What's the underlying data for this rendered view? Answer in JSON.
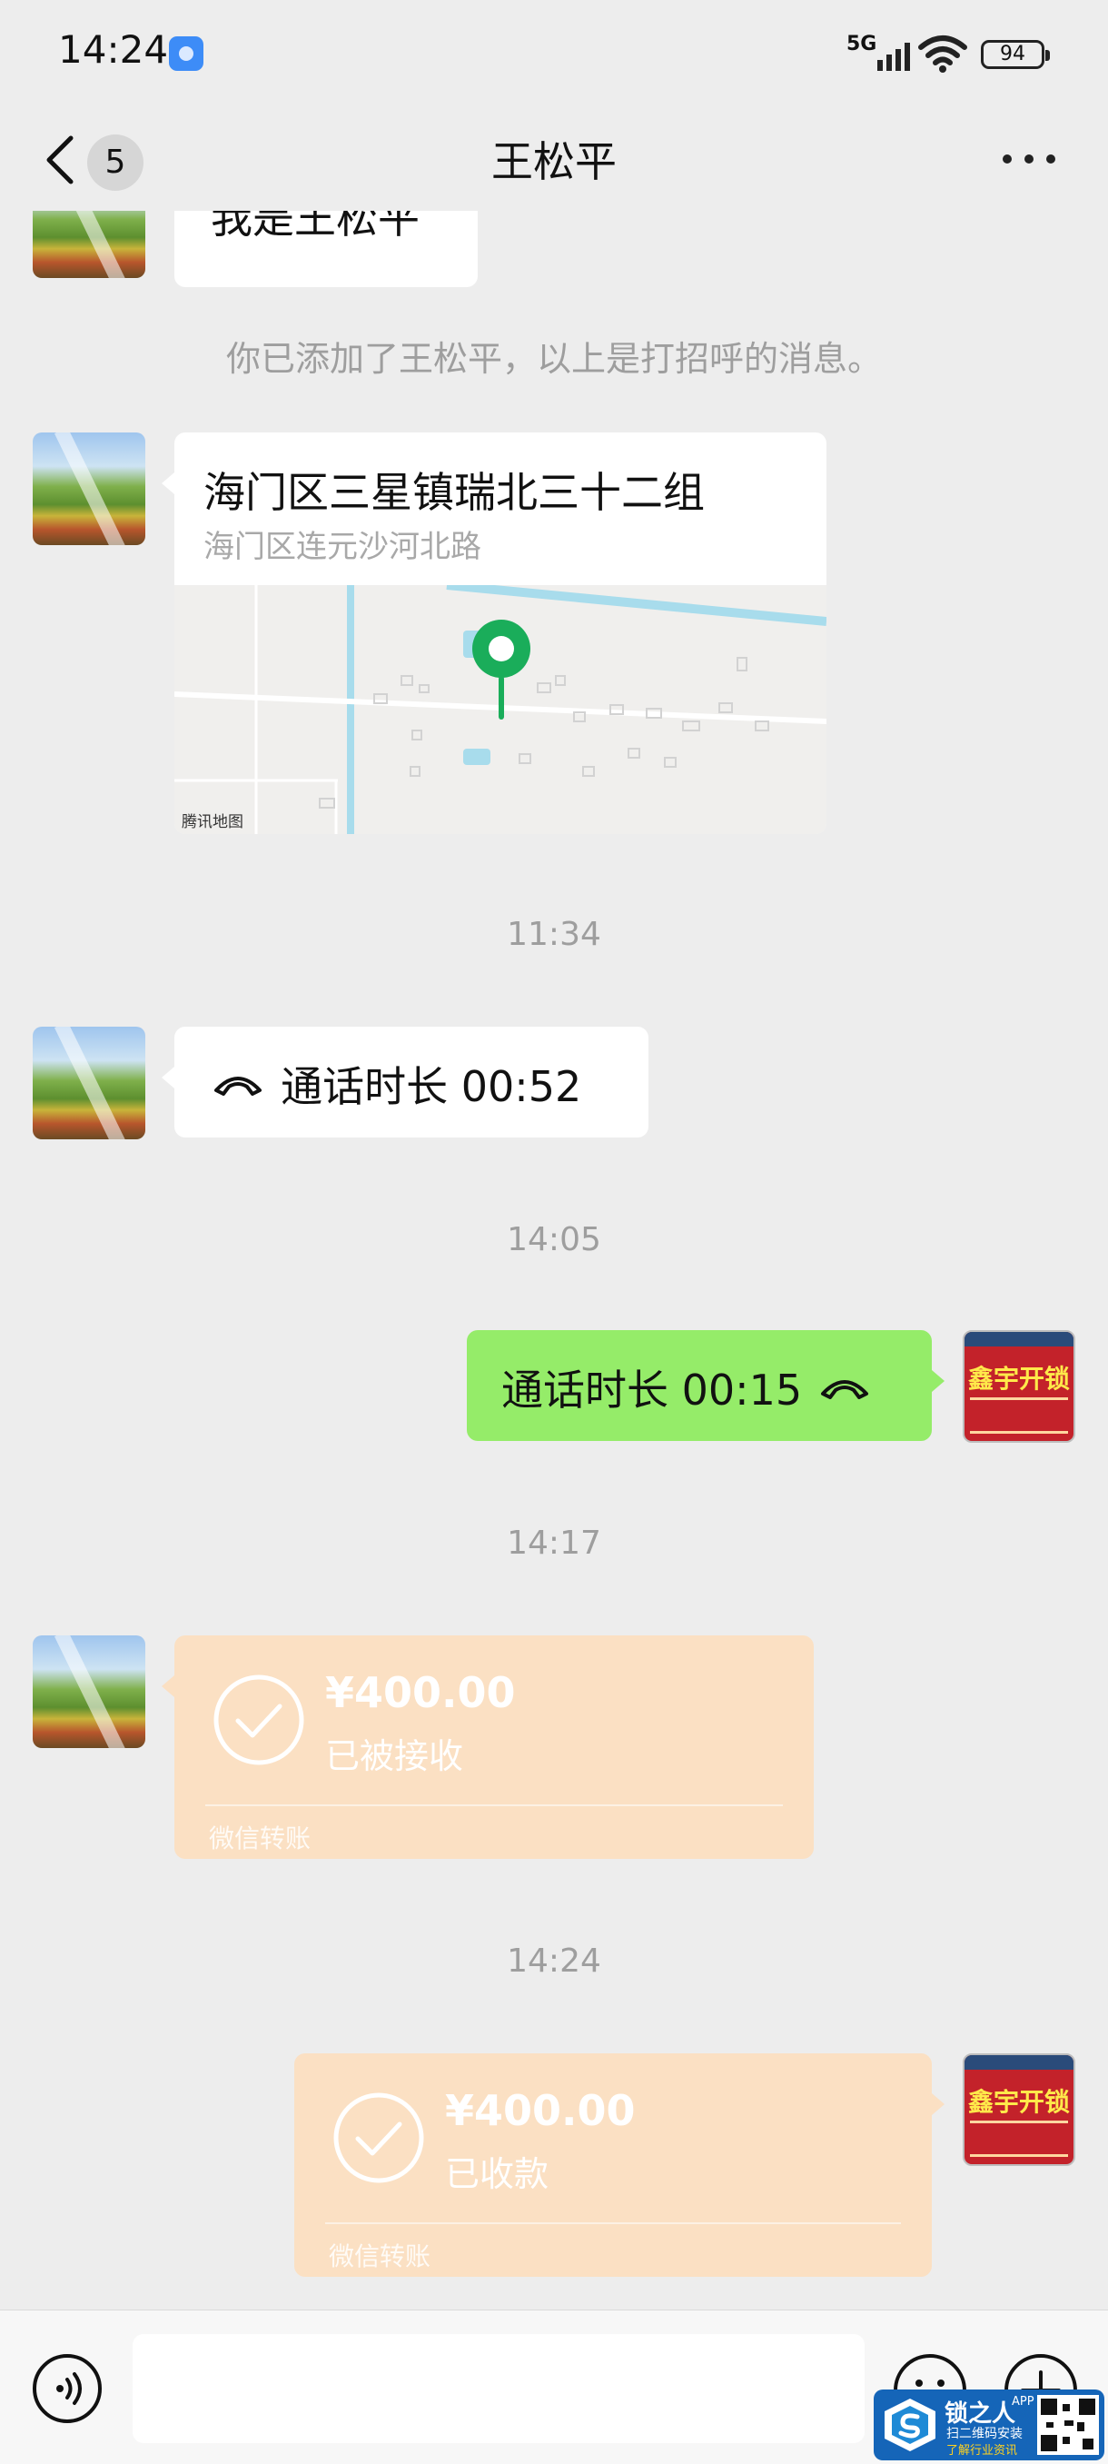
{
  "status_bar": {
    "time": "14:24",
    "network": "5G",
    "battery": "94"
  },
  "nav": {
    "unread_count": "5",
    "title": "王松平"
  },
  "messages": {
    "partial_text": "我是王松平",
    "system_note": "你已添加了王松平，以上是打招呼的消息。",
    "location": {
      "title": "海门区三星镇瑞北三十二组",
      "subtitle": "海门区连元沙河北路",
      "map_credit": "腾讯地图"
    },
    "time_1": "11:34",
    "call_incoming": "通话时长 00:52",
    "time_2": "14:05",
    "call_outgoing": "通话时长 00:15",
    "time_3": "14:17",
    "transfer_1": {
      "amount": "¥400.00",
      "status": "已被接收",
      "label": "微信转账"
    },
    "time_4": "14:24",
    "transfer_2": {
      "amount": "¥400.00",
      "status": "已收款",
      "label": "微信转账"
    }
  },
  "self_avatar": {
    "text": "鑫宇开锁"
  },
  "watermark": {
    "title": "锁之人",
    "badge": "APP",
    "line1": "扫二维码安装",
    "line2": "了解行业资讯"
  },
  "colors": {
    "background": "#ededed",
    "bubble_peer": "#ffffff",
    "bubble_self": "#95ec69",
    "transfer_received": "#fbe0c3",
    "map_pin": "#1aad5a"
  }
}
